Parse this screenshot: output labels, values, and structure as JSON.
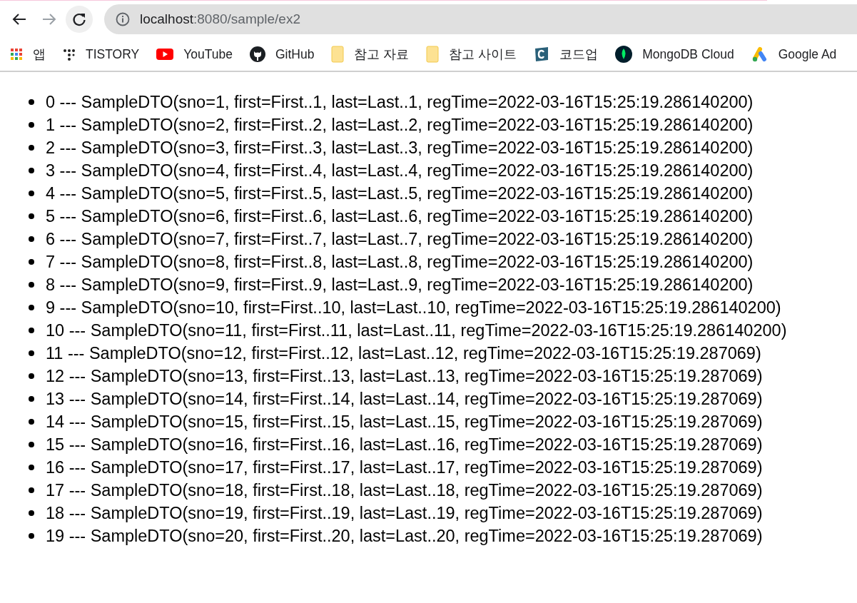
{
  "toolbar": {
    "address": {
      "host": "localhost",
      "path": ":8080/sample/ex2"
    },
    "forward_disabled": true
  },
  "bookmarks": [
    {
      "label": "앱",
      "kind": "apps"
    },
    {
      "label": "TISTORY",
      "kind": "tistory"
    },
    {
      "label": "YouTube",
      "kind": "youtube"
    },
    {
      "label": "GitHub",
      "kind": "github"
    },
    {
      "label": "참고 자료",
      "kind": "folder"
    },
    {
      "label": "참고 사이트",
      "kind": "folder"
    },
    {
      "label": "코드업",
      "kind": "codeup"
    },
    {
      "label": "MongoDB Cloud",
      "kind": "mongodb"
    },
    {
      "label": "Google Ad",
      "kind": "google-ads"
    }
  ],
  "items": [
    "0 --- SampleDTO(sno=1, first=First..1, last=Last..1, regTime=2022-03-16T15:25:19.286140200)",
    "1 --- SampleDTO(sno=2, first=First..2, last=Last..2, regTime=2022-03-16T15:25:19.286140200)",
    "2 --- SampleDTO(sno=3, first=First..3, last=Last..3, regTime=2022-03-16T15:25:19.286140200)",
    "3 --- SampleDTO(sno=4, first=First..4, last=Last..4, regTime=2022-03-16T15:25:19.286140200)",
    "4 --- SampleDTO(sno=5, first=First..5, last=Last..5, regTime=2022-03-16T15:25:19.286140200)",
    "5 --- SampleDTO(sno=6, first=First..6, last=Last..6, regTime=2022-03-16T15:25:19.286140200)",
    "6 --- SampleDTO(sno=7, first=First..7, last=Last..7, regTime=2022-03-16T15:25:19.286140200)",
    "7 --- SampleDTO(sno=8, first=First..8, last=Last..8, regTime=2022-03-16T15:25:19.286140200)",
    "8 --- SampleDTO(sno=9, first=First..9, last=Last..9, regTime=2022-03-16T15:25:19.286140200)",
    "9 --- SampleDTO(sno=10, first=First..10, last=Last..10, regTime=2022-03-16T15:25:19.286140200)",
    "10 --- SampleDTO(sno=11, first=First..11, last=Last..11, regTime=2022-03-16T15:25:19.286140200)",
    "11 --- SampleDTO(sno=12, first=First..12, last=Last..12, regTime=2022-03-16T15:25:19.287069)",
    "12 --- SampleDTO(sno=13, first=First..13, last=Last..13, regTime=2022-03-16T15:25:19.287069)",
    "13 --- SampleDTO(sno=14, first=First..14, last=Last..14, regTime=2022-03-16T15:25:19.287069)",
    "14 --- SampleDTO(sno=15, first=First..15, last=Last..15, regTime=2022-03-16T15:25:19.287069)",
    "15 --- SampleDTO(sno=16, first=First..16, last=Last..16, regTime=2022-03-16T15:25:19.287069)",
    "16 --- SampleDTO(sno=17, first=First..17, last=Last..17, regTime=2022-03-16T15:25:19.287069)",
    "17 --- SampleDTO(sno=18, first=First..18, last=Last..18, regTime=2022-03-16T15:25:19.287069)",
    "18 --- SampleDTO(sno=19, first=First..19, last=Last..19, regTime=2022-03-16T15:25:19.287069)",
    "19 --- SampleDTO(sno=20, first=First..20, last=Last..20, regTime=2022-03-16T15:25:19.287069)"
  ]
}
